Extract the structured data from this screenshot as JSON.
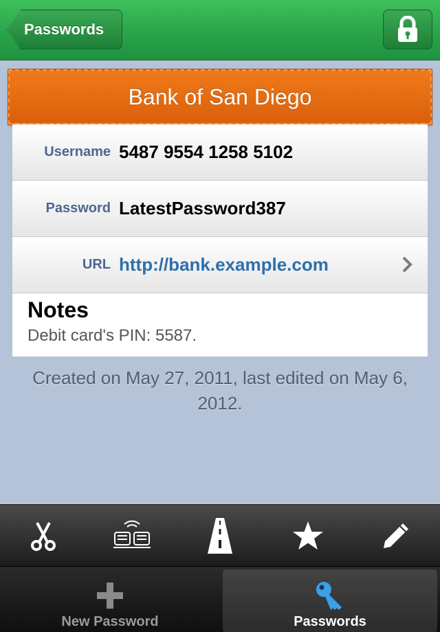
{
  "navbar": {
    "back_label": "Passwords",
    "lock_icon": "lock-icon"
  },
  "entry": {
    "title": "Bank of San Diego",
    "fields": [
      {
        "label": "Username",
        "value": "5487 9554 1258 5102"
      },
      {
        "label": "Password",
        "value": "LatestPassword387"
      },
      {
        "label": "URL",
        "value": "http://bank.example.com"
      }
    ],
    "notes_title": "Notes",
    "notes_body": "Debit card's PIN: 5587.",
    "meta": "Created on May 27, 2011, last edited on May 6, 2012."
  },
  "toolbar": {
    "icons": [
      "scissors-icon",
      "sync-icon",
      "road-icon",
      "star-icon",
      "pencil-icon"
    ]
  },
  "tabs": [
    {
      "label": "New Password",
      "icon": "plus-icon",
      "selected": false
    },
    {
      "label": "Passwords",
      "icon": "key-icon",
      "selected": true
    }
  ],
  "colors": {
    "navbar": "#2aa44a",
    "banner": "#e46c12",
    "link": "#2e6fac",
    "label": "#4e6690",
    "background": "#b4c3d8"
  }
}
